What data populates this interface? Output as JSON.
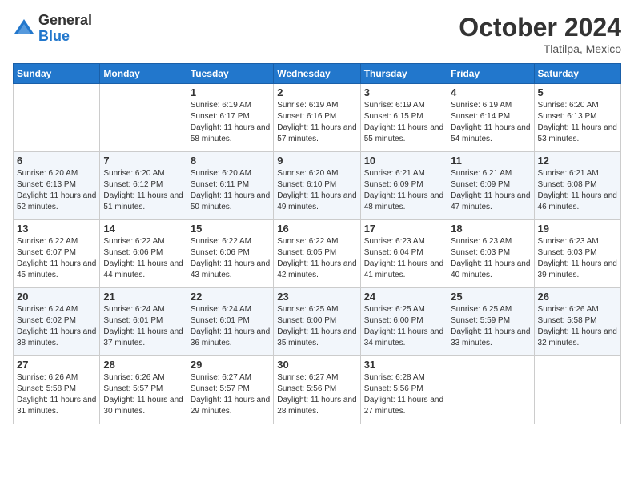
{
  "header": {
    "logo": {
      "general": "General",
      "blue": "Blue"
    },
    "title": "October 2024",
    "location": "Tlatilpa, Mexico"
  },
  "calendar": {
    "days_of_week": [
      "Sunday",
      "Monday",
      "Tuesday",
      "Wednesday",
      "Thursday",
      "Friday",
      "Saturday"
    ],
    "weeks": [
      [
        {
          "day": "",
          "info": ""
        },
        {
          "day": "",
          "info": ""
        },
        {
          "day": "1",
          "info": "Sunrise: 6:19 AM\nSunset: 6:17 PM\nDaylight: 11 hours and 58 minutes."
        },
        {
          "day": "2",
          "info": "Sunrise: 6:19 AM\nSunset: 6:16 PM\nDaylight: 11 hours and 57 minutes."
        },
        {
          "day": "3",
          "info": "Sunrise: 6:19 AM\nSunset: 6:15 PM\nDaylight: 11 hours and 55 minutes."
        },
        {
          "day": "4",
          "info": "Sunrise: 6:19 AM\nSunset: 6:14 PM\nDaylight: 11 hours and 54 minutes."
        },
        {
          "day": "5",
          "info": "Sunrise: 6:20 AM\nSunset: 6:13 PM\nDaylight: 11 hours and 53 minutes."
        }
      ],
      [
        {
          "day": "6",
          "info": "Sunrise: 6:20 AM\nSunset: 6:13 PM\nDaylight: 11 hours and 52 minutes."
        },
        {
          "day": "7",
          "info": "Sunrise: 6:20 AM\nSunset: 6:12 PM\nDaylight: 11 hours and 51 minutes."
        },
        {
          "day": "8",
          "info": "Sunrise: 6:20 AM\nSunset: 6:11 PM\nDaylight: 11 hours and 50 minutes."
        },
        {
          "day": "9",
          "info": "Sunrise: 6:20 AM\nSunset: 6:10 PM\nDaylight: 11 hours and 49 minutes."
        },
        {
          "day": "10",
          "info": "Sunrise: 6:21 AM\nSunset: 6:09 PM\nDaylight: 11 hours and 48 minutes."
        },
        {
          "day": "11",
          "info": "Sunrise: 6:21 AM\nSunset: 6:09 PM\nDaylight: 11 hours and 47 minutes."
        },
        {
          "day": "12",
          "info": "Sunrise: 6:21 AM\nSunset: 6:08 PM\nDaylight: 11 hours and 46 minutes."
        }
      ],
      [
        {
          "day": "13",
          "info": "Sunrise: 6:22 AM\nSunset: 6:07 PM\nDaylight: 11 hours and 45 minutes."
        },
        {
          "day": "14",
          "info": "Sunrise: 6:22 AM\nSunset: 6:06 PM\nDaylight: 11 hours and 44 minutes."
        },
        {
          "day": "15",
          "info": "Sunrise: 6:22 AM\nSunset: 6:06 PM\nDaylight: 11 hours and 43 minutes."
        },
        {
          "day": "16",
          "info": "Sunrise: 6:22 AM\nSunset: 6:05 PM\nDaylight: 11 hours and 42 minutes."
        },
        {
          "day": "17",
          "info": "Sunrise: 6:23 AM\nSunset: 6:04 PM\nDaylight: 11 hours and 41 minutes."
        },
        {
          "day": "18",
          "info": "Sunrise: 6:23 AM\nSunset: 6:03 PM\nDaylight: 11 hours and 40 minutes."
        },
        {
          "day": "19",
          "info": "Sunrise: 6:23 AM\nSunset: 6:03 PM\nDaylight: 11 hours and 39 minutes."
        }
      ],
      [
        {
          "day": "20",
          "info": "Sunrise: 6:24 AM\nSunset: 6:02 PM\nDaylight: 11 hours and 38 minutes."
        },
        {
          "day": "21",
          "info": "Sunrise: 6:24 AM\nSunset: 6:01 PM\nDaylight: 11 hours and 37 minutes."
        },
        {
          "day": "22",
          "info": "Sunrise: 6:24 AM\nSunset: 6:01 PM\nDaylight: 11 hours and 36 minutes."
        },
        {
          "day": "23",
          "info": "Sunrise: 6:25 AM\nSunset: 6:00 PM\nDaylight: 11 hours and 35 minutes."
        },
        {
          "day": "24",
          "info": "Sunrise: 6:25 AM\nSunset: 6:00 PM\nDaylight: 11 hours and 34 minutes."
        },
        {
          "day": "25",
          "info": "Sunrise: 6:25 AM\nSunset: 5:59 PM\nDaylight: 11 hours and 33 minutes."
        },
        {
          "day": "26",
          "info": "Sunrise: 6:26 AM\nSunset: 5:58 PM\nDaylight: 11 hours and 32 minutes."
        }
      ],
      [
        {
          "day": "27",
          "info": "Sunrise: 6:26 AM\nSunset: 5:58 PM\nDaylight: 11 hours and 31 minutes."
        },
        {
          "day": "28",
          "info": "Sunrise: 6:26 AM\nSunset: 5:57 PM\nDaylight: 11 hours and 30 minutes."
        },
        {
          "day": "29",
          "info": "Sunrise: 6:27 AM\nSunset: 5:57 PM\nDaylight: 11 hours and 29 minutes."
        },
        {
          "day": "30",
          "info": "Sunrise: 6:27 AM\nSunset: 5:56 PM\nDaylight: 11 hours and 28 minutes."
        },
        {
          "day": "31",
          "info": "Sunrise: 6:28 AM\nSunset: 5:56 PM\nDaylight: 11 hours and 27 minutes."
        },
        {
          "day": "",
          "info": ""
        },
        {
          "day": "",
          "info": ""
        }
      ]
    ]
  }
}
